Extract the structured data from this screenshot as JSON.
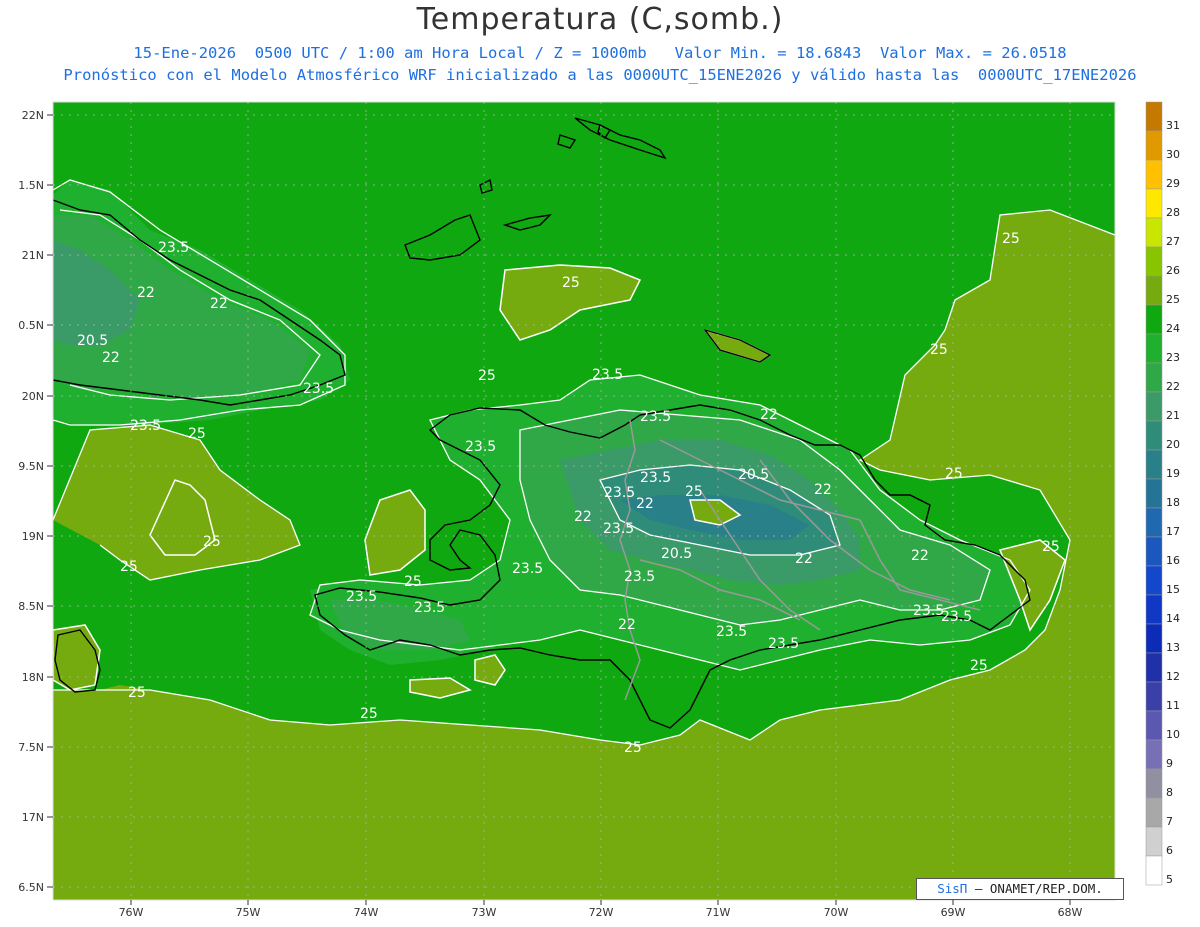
{
  "header": {
    "title": "Temperatura (C,somb.)",
    "subtitle1": "15-Ene-2026  0500 UTC / 1:00 am Hora Local / Z = 1000mb   Valor Min. = 18.6843  Valor Max. = 26.0518",
    "subtitle2": "Pronóstico con el Modelo Atmosférico WRF inicializado a las 0000UTC_15ENE2026 y válido hasta las  0000UTC_17ENE2026"
  },
  "axes": {
    "lat_labels": [
      "22N",
      "1.5N",
      "21N",
      "0.5N",
      "20N",
      "9.5N",
      "19N",
      "8.5N",
      "18N",
      "7.5N",
      "17N",
      "6.5N"
    ],
    "lon_labels": [
      "76W",
      "75W",
      "74W",
      "73W",
      "72W",
      "71W",
      "70W",
      "69W",
      "68W"
    ]
  },
  "colorbar": {
    "labels": [
      "31",
      "30",
      "29",
      "28",
      "27",
      "26",
      "25",
      "24",
      "23",
      "22",
      "21",
      "20",
      "19",
      "18",
      "17",
      "16",
      "15",
      "14",
      "13",
      "12",
      "11",
      "10",
      "9",
      "8",
      "7",
      "6",
      "5"
    ],
    "colors": [
      "#c47a00",
      "#e09a00",
      "#ffc000",
      "#ffe800",
      "#c8e600",
      "#88c400",
      "#76ab10",
      "#10a810",
      "#20b030",
      "#30a848",
      "#3a9a68",
      "#2f8c78",
      "#2a8088",
      "#257496",
      "#2068b0",
      "#1a58c0",
      "#1448cc",
      "#1038c4",
      "#0c2cb8",
      "#1f30a8",
      "#3a40a8",
      "#5a58b0",
      "#7870b4",
      "#9090a0",
      "#a8a8a8",
      "#d0d0d0",
      "#ffffff"
    ]
  },
  "contour_labels": [
    {
      "text": "23.5"
    },
    {
      "text": "22"
    },
    {
      "text": "22"
    },
    {
      "text": "20.5"
    },
    {
      "text": "22"
    },
    {
      "text": "23.5"
    },
    {
      "text": "23.5"
    },
    {
      "text": "25"
    },
    {
      "text": "25"
    },
    {
      "text": "25"
    },
    {
      "text": "25"
    },
    {
      "text": "25"
    },
    {
      "text": "23.5"
    },
    {
      "text": "23.5"
    },
    {
      "text": "22"
    },
    {
      "text": "23.5"
    },
    {
      "text": "23.5"
    },
    {
      "text": "25"
    },
    {
      "text": "20.5"
    },
    {
      "text": "22"
    },
    {
      "text": "22"
    },
    {
      "text": "23.5"
    },
    {
      "text": "22"
    },
    {
      "text": "20.5"
    },
    {
      "text": "22"
    },
    {
      "text": "23.5"
    },
    {
      "text": "23.5"
    },
    {
      "text": "22"
    },
    {
      "text": "23.5"
    },
    {
      "text": "23.5"
    },
    {
      "text": "22"
    },
    {
      "text": "23.5"
    },
    {
      "text": "23.5"
    },
    {
      "text": "23.5"
    },
    {
      "text": "25"
    },
    {
      "text": "23.5"
    },
    {
      "text": "23.5"
    },
    {
      "text": "25"
    },
    {
      "text": "25"
    },
    {
      "text": "25"
    },
    {
      "text": "25"
    },
    {
      "text": "25"
    },
    {
      "text": "25"
    },
    {
      "text": "25"
    },
    {
      "text": "25"
    }
  ],
  "credit": {
    "logo": "SisΠ",
    "text": " – ONAMET/REP.DOM."
  }
}
